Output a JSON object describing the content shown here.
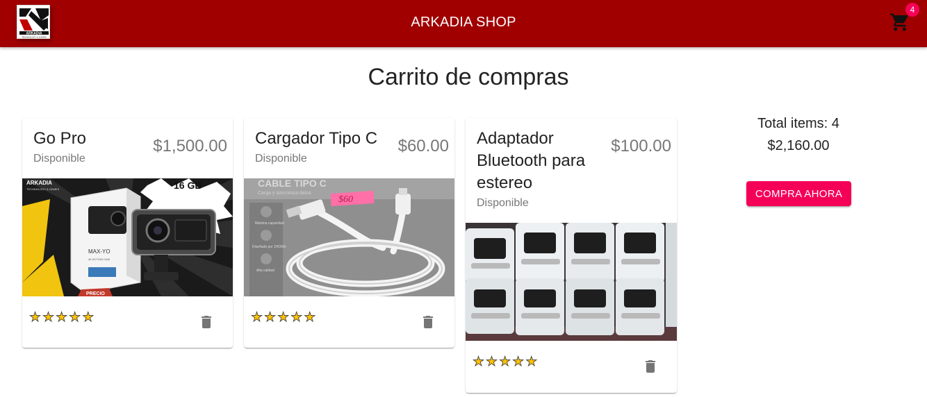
{
  "app": {
    "title": "ARKADIA SHOP",
    "logo_text": "ARKADIA",
    "logo_tagline": "TECHNOLOGY & GAMES",
    "cart_count": "4"
  },
  "page": {
    "title": "Carrito de compras"
  },
  "products": [
    {
      "title": "Go Pro",
      "status": "Disponible",
      "price": "$1,500.00",
      "rating": 5,
      "image": {
        "brand_text": "ARKADIA",
        "brand_tagline": "TECHNOLOGY & GAMES",
        "capacity_text": "16 GB",
        "box_text": "MAX-YO",
        "box_subtext": "4K ACTION CAM",
        "tag_text": "PRECIO"
      },
      "delete_icon": "trash-icon"
    },
    {
      "title": "Cargador Tipo C",
      "status": "Disponible",
      "price": "$60.00",
      "rating": 5,
      "image": {
        "package_text": "CABLE TIPO C",
        "package_subtext": "Carga y sincroniza datos",
        "price_tag": "$60",
        "side_labels": [
          "Máxima capacidad",
          "Diseñado por 1HORA",
          "Alta calidad"
        ]
      },
      "delete_icon": "trash-icon"
    },
    {
      "title": "Adaptador Bluetooth para estereo",
      "status": "Disponible",
      "price": "$100.00",
      "rating": 5,
      "delete_icon": "trash-icon"
    }
  ],
  "summary": {
    "items_label": "Total items: 4",
    "total": "$2,160.00",
    "buy_label": "COMPRA AHORA"
  },
  "colors": {
    "appbar": "#a00000",
    "accent": "#f50057",
    "star": "#ffc107",
    "icon": "#757575"
  }
}
